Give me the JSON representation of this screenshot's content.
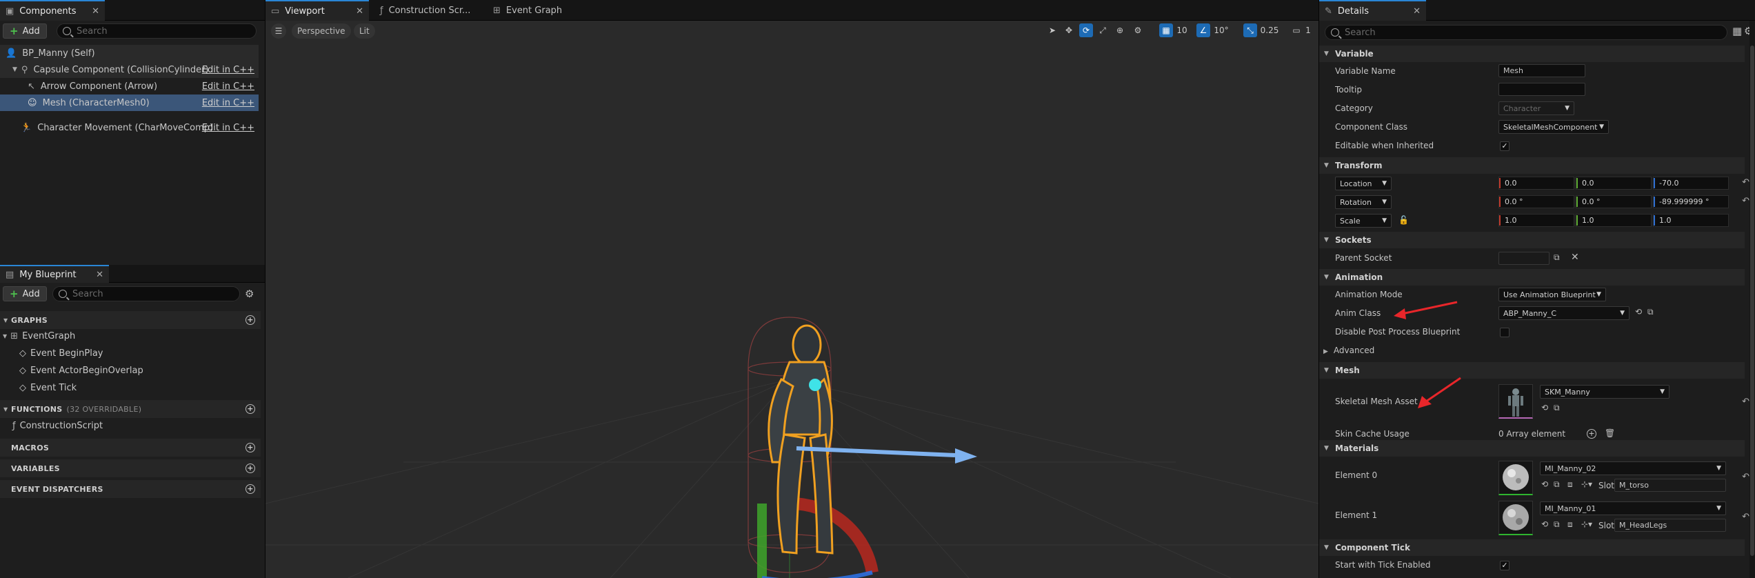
{
  "components_panel": {
    "tab": "Components",
    "add_label": "Add",
    "search_placeholder": "Search",
    "tree": [
      {
        "label": "BP_Manny (Self)",
        "edit": ""
      },
      {
        "label": "Capsule Component (CollisionCylinder)",
        "edit": "Edit in C++"
      },
      {
        "label": "Arrow Component (Arrow)",
        "edit": "Edit in C++"
      },
      {
        "label": "Mesh (CharacterMesh0)",
        "edit": "Edit in C++"
      },
      {
        "label": "Character Movement (CharMoveComp)",
        "edit": "Edit in C++"
      }
    ]
  },
  "my_blueprint": {
    "tab": "My Blueprint",
    "add_label": "Add",
    "search_placeholder": "Search",
    "graphs_header": "GRAPHS",
    "event_graph": "EventGraph",
    "events": [
      "Event BeginPlay",
      "Event ActorBeginOverlap",
      "Event Tick"
    ],
    "functions_header": "FUNCTIONS",
    "functions_count": "(32 OVERRIDABLE)",
    "construction_script": "ConstructionScript",
    "macros_header": "MACROS",
    "variables_header": "VARIABLES",
    "dispatchers_header": "EVENT DISPATCHERS"
  },
  "editor_tabs": [
    "Viewport",
    "Construction Scr...",
    "Event Graph"
  ],
  "viewport": {
    "perspective": "Perspective",
    "lit": "Lit",
    "grid_snap": "10",
    "rot_snap": "10°",
    "scale_snap": "0.25",
    "camera_speed": "1"
  },
  "details": {
    "tab": "Details",
    "search_placeholder": "Search",
    "variable": {
      "header": "Variable",
      "variable_name_label": "Variable Name",
      "variable_name": "Mesh",
      "tooltip_label": "Tooltip",
      "tooltip": "",
      "category_label": "Category",
      "category": "Character",
      "component_class_label": "Component Class",
      "component_class": "SkeletalMeshComponent",
      "editable_label": "Editable when Inherited",
      "editable_checked": true
    },
    "transform": {
      "header": "Transform",
      "location_label": "Location",
      "location": [
        "0.0",
        "0.0",
        "-70.0"
      ],
      "rotation_label": "Rotation",
      "rotation": [
        "0.0 °",
        "0.0 °",
        "-89.999999 °"
      ],
      "scale_label": "Scale",
      "scale": [
        "1.0",
        "1.0",
        "1.0"
      ]
    },
    "sockets": {
      "header": "Sockets",
      "parent_socket_label": "Parent Socket"
    },
    "animation": {
      "header": "Animation",
      "mode_label": "Animation Mode",
      "mode": "Use Animation Blueprint",
      "class_label": "Anim Class",
      "class": "ABP_Manny_C",
      "disable_pp_label": "Disable Post Process Blueprint",
      "advanced": "Advanced"
    },
    "mesh": {
      "header": "Mesh",
      "asset_label": "Skeletal Mesh Asset",
      "asset": "SKM_Manny",
      "skin_cache_label": "Skin Cache Usage",
      "skin_cache": "0 Array element"
    },
    "materials": {
      "header": "Materials",
      "elements": [
        {
          "label": "Element 0",
          "material": "MI_Manny_02",
          "slot_label": "Slot",
          "slot": "M_torso"
        },
        {
          "label": "Element 1",
          "material": "MI_Manny_01",
          "slot_label": "Slot",
          "slot": "M_HeadLegs"
        }
      ]
    },
    "component_tick": {
      "header": "Component Tick",
      "start_label": "Start with Tick Enabled",
      "start_checked": true
    }
  },
  "colors": {
    "accent": "#2a86d6",
    "selection": "#3b5679",
    "annotation_arrow": "#e8262a"
  }
}
